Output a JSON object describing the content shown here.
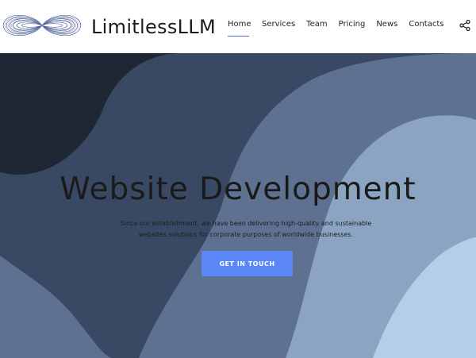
{
  "brand": {
    "name": "LimitlessLLM",
    "logo_icon": "infinity-logo-icon"
  },
  "nav": {
    "items": [
      {
        "label": "Home",
        "active": true
      },
      {
        "label": "Services",
        "active": false
      },
      {
        "label": "Team",
        "active": false
      },
      {
        "label": "Pricing",
        "active": false
      },
      {
        "label": "News",
        "active": false
      },
      {
        "label": "Contacts",
        "active": false
      }
    ],
    "share_icon": "share-icon"
  },
  "hero": {
    "title": "Website Development",
    "subtitle_line1": "Since our establishment, we have been delivering high-quality and sustainable",
    "subtitle_line2": "websites solutions for corporate purposes of worldwide businesses.",
    "cta_label": "GET IN TOUCH"
  },
  "colors": {
    "accent": "#5b86f5",
    "nav_underline": "#4b6ee8",
    "wave_darkest": "#1f2634",
    "wave_dark": "#3a4963",
    "wave_mid": "#5f7190",
    "wave_light": "#8aa4c2",
    "wave_lightest": "#b3cfe8"
  }
}
